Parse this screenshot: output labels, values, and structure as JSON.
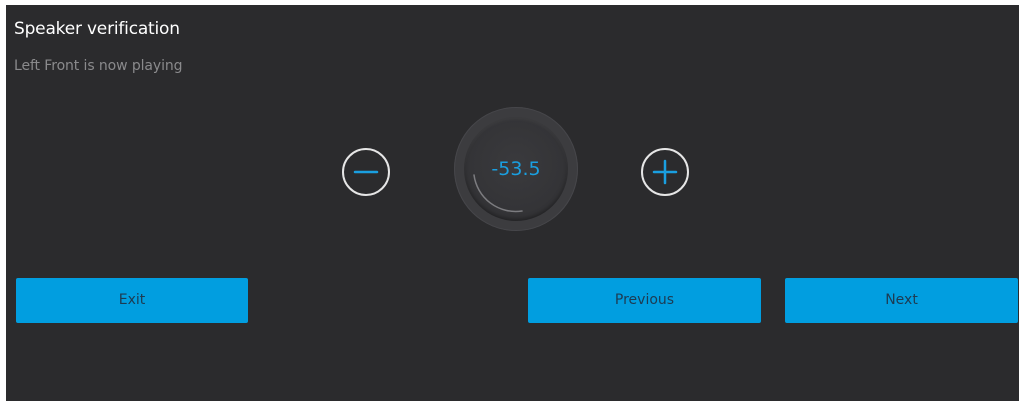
{
  "header": {
    "title": "Speaker verification",
    "status": "Left Front is now playing"
  },
  "level_control": {
    "value": "-53.5",
    "decrement_icon": "minus-circle-icon",
    "increment_icon": "plus-circle-icon"
  },
  "actions": {
    "exit_label": "Exit",
    "previous_label": "Previous",
    "next_label": "Next"
  },
  "colors": {
    "background": "#2b2b2d",
    "accent": "#019ee0",
    "title_text": "#ffffff",
    "subtitle_text": "#8a8a8c",
    "button_text": "#1d3b52"
  }
}
